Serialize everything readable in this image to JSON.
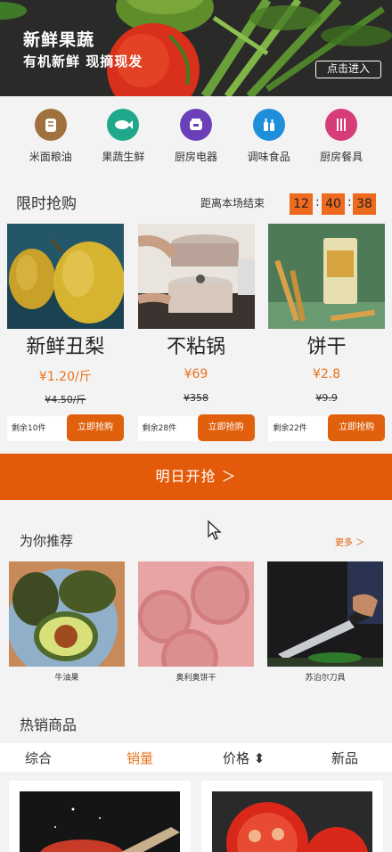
{
  "banner": {
    "title": "新鲜果蔬",
    "subtitle": "有机新鲜 现摘现发",
    "cta": "点击进入"
  },
  "categories": [
    {
      "label": "米面粮油",
      "icon": "grain-icon",
      "color": "#a0703f"
    },
    {
      "label": "果蔬生鲜",
      "icon": "fish-icon",
      "color": "#1fa98a"
    },
    {
      "label": "厨房电器",
      "icon": "rice-cooker-icon",
      "color": "#6b3fb8"
    },
    {
      "label": "调味食品",
      "icon": "bottles-icon",
      "color": "#1e8fd8"
    },
    {
      "label": "厨房餐具",
      "icon": "cutlery-icon",
      "color": "#d63c78"
    }
  ],
  "flash_sale": {
    "title": "限时抢购",
    "countdown_label": "距离本场结束",
    "hours": "12",
    "minutes": "40",
    "seconds": "38",
    "sep": ":",
    "items": [
      {
        "name": "新鲜丑梨",
        "price": "¥1.20/斤",
        "old_price": "¥4.50/斤",
        "stock": "剩余10件",
        "buy": "立即抢购"
      },
      {
        "name": "不粘锅",
        "price": "¥69",
        "old_price": "¥358",
        "stock": "剩余28件",
        "buy": "立即抢购"
      },
      {
        "name": "饼干",
        "price": "¥2.8",
        "old_price": "¥9.9",
        "stock": "剩余22件",
        "buy": "立即抢购"
      }
    ],
    "tomorrow": "明日开抢 ＞"
  },
  "recommend": {
    "title": "为你推荐",
    "more": "更多 ＞",
    "items": [
      {
        "label": "牛油果"
      },
      {
        "label": "奥利奥饼干"
      },
      {
        "label": "苏泊尔刀具"
      }
    ]
  },
  "hot": {
    "title": "热销商品",
    "sorts": [
      "综合",
      "销量",
      "价格 ⬍",
      "新品"
    ],
    "active_sort": "销量"
  },
  "colors": {
    "accent": "#e35b0a",
    "price": "#e8731e"
  }
}
